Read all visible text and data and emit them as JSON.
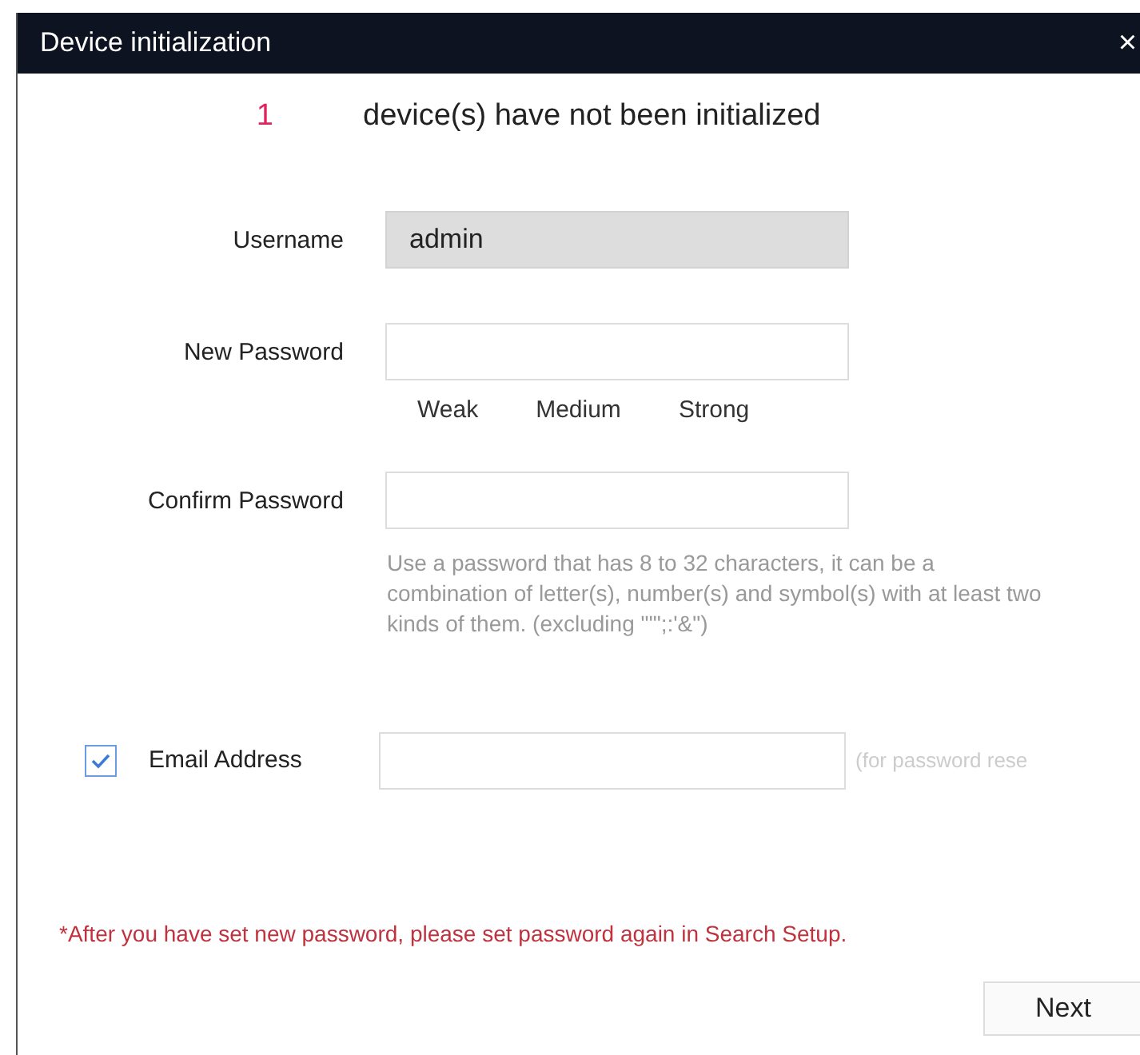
{
  "window": {
    "title": "Device initialization",
    "close": "×"
  },
  "status": {
    "count": "1",
    "message": "device(s) have not been initialized"
  },
  "form": {
    "username": {
      "label": "Username",
      "value": "admin",
      "disabled": true
    },
    "new_password": {
      "label": "New Password"
    },
    "strength": [
      "Weak",
      "Medium",
      "Strong"
    ],
    "confirm_password": {
      "label": "Confirm Password"
    },
    "hint": "Use a password that has 8 to 32 characters, it can be a combination of letter(s), number(s) and symbol(s) with at least two kinds of them. (excluding \"'\";:'&\")",
    "email": {
      "label": "Email Address",
      "checked": true,
      "suffix": "(for password rese"
    }
  },
  "notice": "*After you have set new password, please set password again in Search Setup.",
  "buttons": [
    "Next"
  ]
}
